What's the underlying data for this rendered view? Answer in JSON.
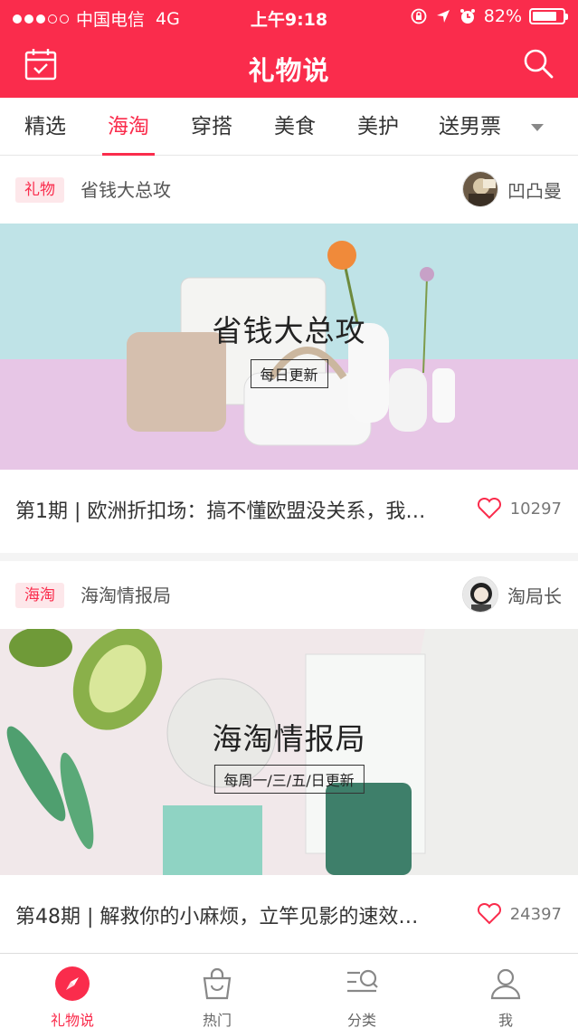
{
  "status_bar": {
    "carrier": "中国电信",
    "network": "4G",
    "time": "上午9:18",
    "battery_text": "82%",
    "battery_level": 0.82
  },
  "header": {
    "title": "礼物说",
    "left_icon": "calendar-check-icon",
    "right_icon": "search-icon"
  },
  "tabs": [
    {
      "label": "精选"
    },
    {
      "label": "海淘"
    },
    {
      "label": "穿搭"
    },
    {
      "label": "美食"
    },
    {
      "label": "美护"
    },
    {
      "label": "送男票"
    }
  ],
  "active_tab": "海淘",
  "cards": [
    {
      "tag": "礼物",
      "column": "省钱大总攻",
      "author": "凹凸曼",
      "banner_title": "省钱大总攻",
      "banner_subtitle": "每日更新",
      "title": "第1期 | 欧洲折扣场：搞不懂欧盟没关系，我…",
      "likes": "10297"
    },
    {
      "tag": "海淘",
      "column": "海淘情报局",
      "author": "淘局长",
      "banner_title": "海淘情报局",
      "banner_subtitle": "每周一/三/五/日更新",
      "title": "第48期 | 解救你的小麻烦，立竿见影的速效…",
      "likes": "24397"
    }
  ],
  "bottom_nav": [
    {
      "label": "礼物说",
      "icon": "compass-icon"
    },
    {
      "label": "热门",
      "icon": "shopping-bag-icon"
    },
    {
      "label": "分类",
      "icon": "category-search-icon"
    },
    {
      "label": "我",
      "icon": "user-icon"
    }
  ],
  "colors": {
    "accent": "#fa2c4c",
    "tag_bg": "#fde7ea"
  }
}
